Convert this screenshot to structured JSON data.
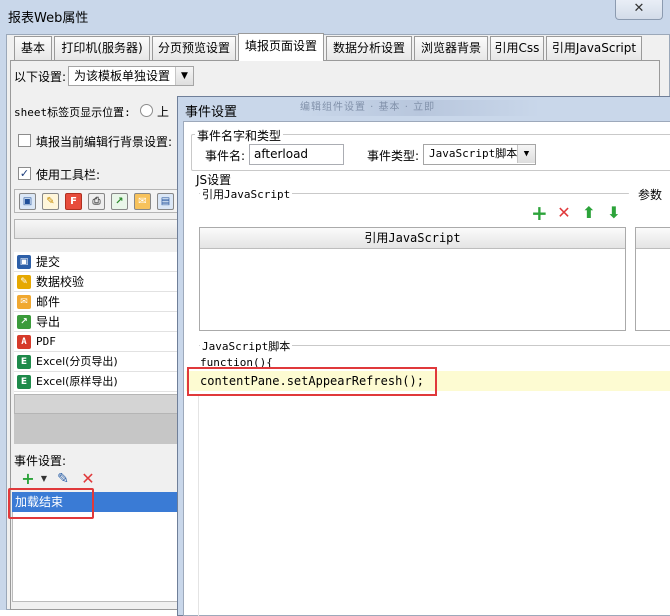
{
  "window": {
    "title": "报表Web属性",
    "close_label": "✕"
  },
  "tabs": [
    {
      "label": "基本"
    },
    {
      "label": "打印机(服务器)"
    },
    {
      "label": "分页预览设置"
    },
    {
      "label": "填报页面设置"
    },
    {
      "label": "数据分析设置"
    },
    {
      "label": "浏览器背景"
    },
    {
      "label": "引用Css"
    },
    {
      "label": "引用JavaScript"
    }
  ],
  "settings": {
    "following_label": "以下设置:",
    "following_value": "为该模板单独设置",
    "sheet_tab_label": "sheet标签页显示位置:",
    "sheet_tab_option": "上",
    "bg_label": "填报当前编辑行背景设置:",
    "toolbar_label": "使用工具栏:"
  },
  "toolbar_items": [
    {
      "label": "提交",
      "icon": "save-icon"
    },
    {
      "label": "数据校验",
      "icon": "pencil-check-icon"
    },
    {
      "label": "邮件",
      "icon": "mail-icon"
    },
    {
      "label": "导出",
      "icon": "export-icon"
    },
    {
      "label": "PDF",
      "icon": "pdf-icon"
    },
    {
      "label": "Excel(分页导出)",
      "icon": "excel-icon"
    },
    {
      "label": "Excel(原样导出)",
      "icon": "excel-icon"
    }
  ],
  "events": {
    "label": "事件设置:",
    "items": [
      {
        "label": "加载结束"
      }
    ]
  },
  "dialog": {
    "title": "事件设置",
    "blurred_text": "编辑组件设置 · 基本 · 立即",
    "name_group": "事件名字和类型",
    "name_label": "事件名:",
    "name_value": "afterload",
    "type_label": "事件类型:",
    "type_value": "JavaScript脚本",
    "js_settings": "JS设置",
    "ref_js_group": "引用JavaScript",
    "param_group": "参数",
    "table_header": "引用JavaScript",
    "script_group": "JavaScript脚本",
    "code_lines": [
      "function(){",
      "contentPane.setAppearRefresh();"
    ]
  },
  "colors": {
    "accent_red": "#e0393b",
    "add_green": "#2ca33a",
    "selection_blue": "#3a7bd5",
    "highlight": "#fdfbd2"
  }
}
